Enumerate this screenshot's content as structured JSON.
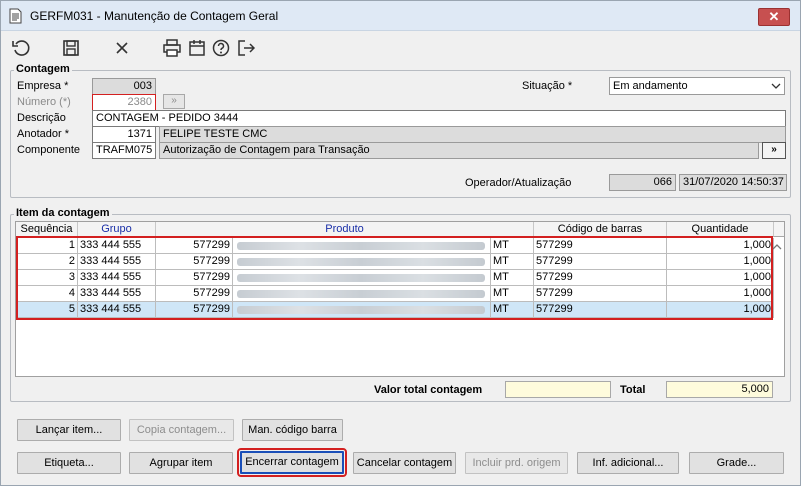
{
  "window": {
    "title": "GERFM031 - Manutenção de Contagem Geral",
    "close_glyph": "✕"
  },
  "toolbar": {
    "icons": [
      "undo-icon",
      "save-icon",
      "cancel-icon",
      "print-icon",
      "calendar-icon",
      "help-icon",
      "exit-icon"
    ]
  },
  "contagem": {
    "group_label": "Contagem",
    "empresa_label": "Empresa *",
    "empresa_value": "003",
    "numero_label": "Número (*)",
    "numero_value": "2380",
    "numero_button": "»",
    "situacao_label": "Situação *",
    "situacao_value": "Em andamento",
    "descricao_label": "Descrição",
    "descricao_value": "CONTAGEM - PEDIDO 3444",
    "anotador_label": "Anotador *",
    "anotador_code": "1371",
    "anotador_name": "FELIPE TESTE CMC",
    "componente_label": "Componente",
    "componente_code": "TRAFM075",
    "componente_desc": "Autorização de Contagem para Transação",
    "componente_button": "»",
    "operador_label": "Operador/Atualização",
    "operador_code": "066",
    "operador_datetime": "31/07/2020 14:50:37"
  },
  "items": {
    "group_label": "Item da contagem",
    "columns": {
      "sequencia": "Sequência",
      "grupo": "Grupo",
      "produto": "Produto",
      "codigo_barras": "Código de barras",
      "quantidade": "Quantidade"
    },
    "rows": [
      {
        "seq": "1",
        "grupo": "333 444 555",
        "produto_code": "577299",
        "unit": "MT",
        "barcode": "577299",
        "qty": "1,000"
      },
      {
        "seq": "2",
        "grupo": "333 444 555",
        "produto_code": "577299",
        "unit": "MT",
        "barcode": "577299",
        "qty": "1,000"
      },
      {
        "seq": "3",
        "grupo": "333 444 555",
        "produto_code": "577299",
        "unit": "MT",
        "barcode": "577299",
        "qty": "1,000"
      },
      {
        "seq": "4",
        "grupo": "333 444 555",
        "produto_code": "577299",
        "unit": "MT",
        "barcode": "577299",
        "qty": "1,000"
      },
      {
        "seq": "5",
        "grupo": "333 444 555",
        "produto_code": "577299",
        "unit": "MT",
        "barcode": "577299",
        "qty": "1,000"
      }
    ],
    "selected_row": 5
  },
  "totals": {
    "valor_total_label": "Valor total contagem",
    "valor_total_value": "",
    "total_label": "Total",
    "total_value": "5,000"
  },
  "buttons": {
    "lancar_item": "Lançar item...",
    "copia_contagem": "Copia contagem...",
    "man_codigo_barra": "Man. código barra",
    "etiqueta": "Etiqueta...",
    "agrupar_item": "Agrupar item",
    "encerrar_contagem": "Encerrar contagem",
    "cancelar_contagem": "Cancelar contagem",
    "incluir_prd_origem": "Incluir prd. origem",
    "inf_adicional": "Inf. adicional...",
    "grade": "Grade..."
  },
  "colors": {
    "highlight_red": "#d32020",
    "selected_row": "#cfe6f7",
    "header_blue": "#1a2fa8",
    "total_field": "#fefbdc"
  }
}
